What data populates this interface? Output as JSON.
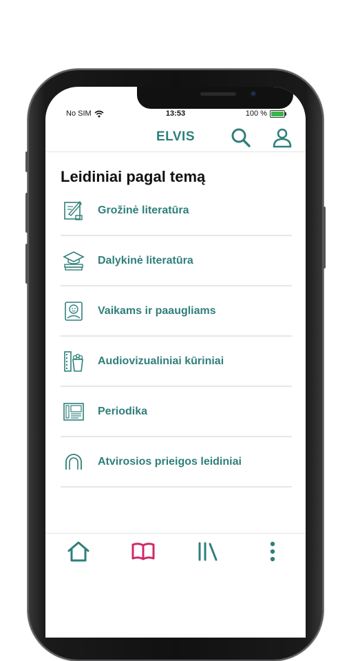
{
  "status_bar": {
    "carrier": "No SIM",
    "time": "13:53",
    "battery": "100 %"
  },
  "app_bar": {
    "title": "ELVIS"
  },
  "page": {
    "heading": "Leidiniai pagal temą"
  },
  "categories": [
    {
      "label": "Grožinė literatūra",
      "icon": "quill-paper-icon"
    },
    {
      "label": "Dalykinė literatūra",
      "icon": "graduation-books-icon"
    },
    {
      "label": "Vaikams ir paaugliams",
      "icon": "child-book-icon"
    },
    {
      "label": "Audiovizualiniai kūriniai",
      "icon": "film-popcorn-icon"
    },
    {
      "label": "Periodika",
      "icon": "newspaper-icon"
    },
    {
      "label": "Atvirosios prieigos leidiniai",
      "icon": "open-access-icon"
    }
  ],
  "tab_bar": {
    "items": [
      {
        "name": "home",
        "icon": "home-icon"
      },
      {
        "name": "catalog",
        "icon": "open-book-icon",
        "active": true
      },
      {
        "name": "library",
        "icon": "library-icon"
      },
      {
        "name": "more",
        "icon": "more-vertical-icon"
      }
    ]
  },
  "colors": {
    "accent": "#2e7f7a",
    "active_tab": "#d0286a",
    "divider": "#e6e6e6"
  }
}
